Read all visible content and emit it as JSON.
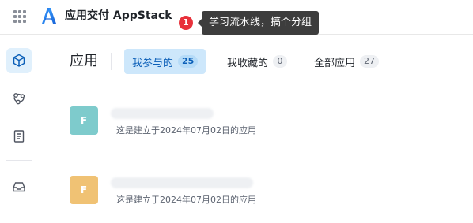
{
  "header": {
    "app_title": "应用交付 AppStack",
    "notification_count": "1",
    "tooltip_text": "学习流水线，搞个分组"
  },
  "sidebar": {
    "items": [
      {
        "icon": "cube-icon",
        "active": true
      },
      {
        "icon": "pipeline-icon",
        "active": false
      },
      {
        "icon": "document-icon",
        "active": false
      },
      {
        "icon": "inbox-icon",
        "active": false
      }
    ]
  },
  "main": {
    "title": "应用",
    "tabs": [
      {
        "label": "我参与的",
        "count": "25",
        "active": true
      },
      {
        "label": "我收藏的",
        "count": "0",
        "active": false
      },
      {
        "label": "全部应用",
        "count": "27",
        "active": false
      }
    ],
    "apps": [
      {
        "avatar_letter": "F",
        "avatar_color": "#7ecbcc",
        "description": "这是建立于2024年07月02日的应用"
      },
      {
        "avatar_letter": "F",
        "avatar_color": "#f0c274",
        "description": "这是建立于2024年07月02日的应用"
      }
    ]
  },
  "colors": {
    "accent": "#0b5fb8",
    "active_tab_bg": "#cde7fb",
    "badge": "#e8313b",
    "tooltip_bg": "#3d3d3d"
  }
}
